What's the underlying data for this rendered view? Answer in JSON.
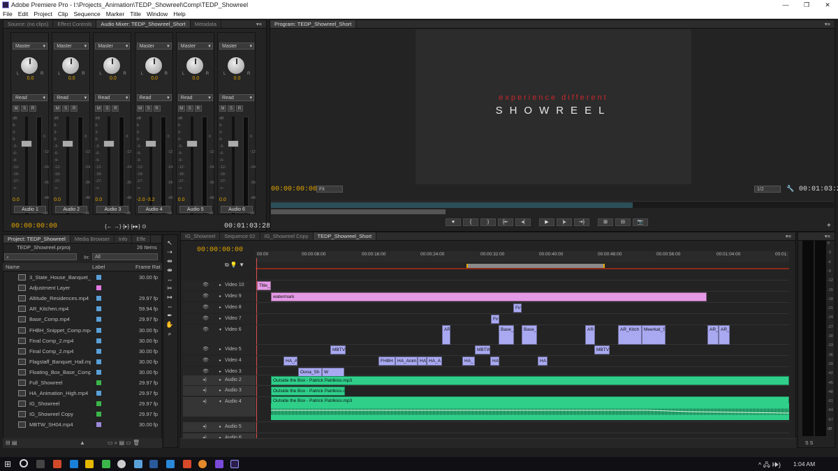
{
  "window": {
    "title": "Adobe Premiere Pro - I:\\Projects_Animation\\TEDP_Showreel\\Comp\\TEDP_Showreel",
    "controls": [
      "—",
      "❐",
      "✕"
    ]
  },
  "menu": [
    "File",
    "Edit",
    "Project",
    "Clip",
    "Sequence",
    "Marker",
    "Title",
    "Window",
    "Help"
  ],
  "source_tabs": [
    "Source: (no clips)",
    "Effect Controls",
    "Audio Mixer: TEDP_Showreel_Short",
    "Metadata"
  ],
  "mixer": {
    "strips": [
      {
        "mode": "Master",
        "pan": "0.0",
        "automation": "Read",
        "value": "0.0",
        "name": "Audio 1"
      },
      {
        "mode": "Master",
        "pan": "0.0",
        "automation": "Read",
        "value": "0.0",
        "name": "Audio 2"
      },
      {
        "mode": "Master",
        "pan": "0.0",
        "automation": "Read",
        "value": "0.0",
        "name": "Audio 3"
      },
      {
        "mode": "Master",
        "pan": "0.0",
        "automation": "Read",
        "value": "-2.0  -3.2",
        "name": "Audio 4"
      },
      {
        "mode": "Master",
        "pan": "0.0",
        "automation": "Read",
        "value": "0.0",
        "name": "Audio 5"
      },
      {
        "mode": "Master",
        "pan": "0.0",
        "automation": "Read",
        "value": "0.0",
        "name": "Audio 6"
      }
    ],
    "timecode_left": "00:00:00:00",
    "timecode_right": "00:01:03:28",
    "transport": "{← →} {▸} {▸▸} ⊙",
    "hsr": [
      "M",
      "S",
      "R"
    ],
    "db_ticks": [
      "dB",
      "6-",
      "3-",
      "0-",
      "-3-",
      "-6-",
      "-9-",
      "-12-",
      "-18-",
      "-27-",
      "-∞"
    ],
    "meter_ticks": [
      "0",
      "-12",
      "-24",
      "-36",
      "-48",
      "dB"
    ]
  },
  "program": {
    "tab": "Program: TEDP_Showreel_Short",
    "tagline": "experience different",
    "title": "SHOWREEL",
    "timecode": "00:00:00:00",
    "fit": "Fit",
    "resolution": "1/2",
    "duration": "00:01:03:28",
    "buttons": [
      "♥",
      "{",
      "}",
      "{⇤",
      "◂|",
      "▶",
      "|▸",
      "⇥}",
      "⊞",
      "⊟",
      "📷"
    ]
  },
  "project": {
    "tabs": [
      "Project: TEDP_Showreel",
      "Media Browser",
      "Info",
      "Effe"
    ],
    "file": "TEDP_Showreel.prproj",
    "count": "26 Items",
    "search_placeholder": "",
    "in_label": "In:",
    "in_value": "All",
    "columns": [
      "Name",
      "Label",
      "Frame Rat"
    ],
    "items": [
      {
        "name": "3_State_House_Banquet_F",
        "color": "#5aa0d8",
        "fps": "30.00 fp"
      },
      {
        "name": "Adjustment Layer",
        "color": "#e47ae4",
        "fps": ""
      },
      {
        "name": "Altitude_Residences.mp4",
        "color": "#5aa0d8",
        "fps": "29.97 fp"
      },
      {
        "name": "AR_Kitchen.mp4",
        "color": "#5aa0d8",
        "fps": "59.94 fp"
      },
      {
        "name": "Base_Comp.mp4",
        "color": "#5aa0d8",
        "fps": "29.97 fp"
      },
      {
        "name": "FHBH_Snippet_Comp.mp4",
        "color": "#5aa0d8",
        "fps": "30.00 fp"
      },
      {
        "name": "Final Comp_2.mp4",
        "color": "#5aa0d8",
        "fps": "30.00 fp"
      },
      {
        "name": "Final Comp_2.mp4",
        "color": "#5aa0d8",
        "fps": "30.00 fp"
      },
      {
        "name": "Flagstaff_Banquet_Hall.mp",
        "color": "#5aa0d8",
        "fps": "30.00 fp"
      },
      {
        "name": "Floating_Box_Base_Comp_",
        "color": "#5aa0d8",
        "fps": "30.00 fp"
      },
      {
        "name": "Full_Showreel",
        "color": "#3bb54a",
        "fps": "29.97 fp"
      },
      {
        "name": "HA_Animation_High.mp4",
        "color": "#5aa0d8",
        "fps": "29.97 fp"
      },
      {
        "name": "IG_Showreel",
        "color": "#3bb54a",
        "fps": "29.97 fp"
      },
      {
        "name": "IG_Showreel Copy",
        "color": "#3bb54a",
        "fps": "29.97 fp"
      },
      {
        "name": "MBTW_SH04.mp4",
        "color": "#9a8ad8",
        "fps": "30.00 fp"
      }
    ]
  },
  "timeline": {
    "tabs": [
      "IG_Showreel",
      "Sequence 02",
      "IG_Showreel Copy",
      "TEDP_Showreel_Short"
    ],
    "timecode": "00:00:00:00",
    "ruler": [
      "00:00",
      "00:00:08:00",
      "00:00:16:00",
      "00:00:24:00",
      "00:00:32:00",
      "00:00:40:00",
      "00:00:48:00",
      "00:00:56:00",
      "00:01:04:00",
      "00:01:"
    ],
    "tracks": [
      {
        "name": "Video 10",
        "type": "v"
      },
      {
        "name": "Video 9",
        "type": "v"
      },
      {
        "name": "Video 8",
        "type": "v"
      },
      {
        "name": "Video 7",
        "type": "v"
      },
      {
        "name": "Video 6",
        "type": "v"
      },
      {
        "name": "Video 5",
        "type": "v"
      },
      {
        "name": "Video 4",
        "type": "v"
      },
      {
        "name": "Video 3",
        "type": "v"
      },
      {
        "name": "Audio 2",
        "type": "a"
      },
      {
        "name": "Audio 3",
        "type": "a"
      },
      {
        "name": "Audio 4",
        "type": "a"
      },
      {
        "name": "Audio 5",
        "type": "a"
      },
      {
        "name": "Audio 6",
        "type": "a"
      }
    ],
    "clips": {
      "title": "Title_",
      "watermark": "watermark",
      "fin": "Fin",
      "fir": "Fir",
      "ar": "AR",
      "base1": "Base_",
      "base2": "Base_",
      "ar2": "AR",
      "ar_kitch": "AR_Kitch",
      "meerkat": "Meerkat_S",
      "ar3": "AR_",
      "ar4": "AR_",
      "mbtv1": "MBTV",
      "mbtw": "MBTW",
      "mbtv2": "MBTV",
      "ha_a": "HA_A",
      "fhbh": "FHBH",
      "ha_anim": "HA_Anim",
      "ha1": "HA",
      "ha_a2": "HA_A",
      "ha_": "HA_",
      "ha2": "HA",
      "ha3": "HA",
      "v3a": "Oona_Sh",
      "v3b": "W",
      "audio": "Outside the Box - Patrick Patrikios.mp3"
    }
  },
  "meter_scale": [
    "0",
    "-3",
    "-6",
    "-9",
    "-12",
    "-15",
    "-18",
    "-21",
    "-24",
    "-27",
    "-30",
    "-33",
    "-36",
    "-39",
    "-42",
    "-45",
    "-48",
    "-51",
    "-54",
    "-57",
    "dB"
  ],
  "taskbar": {
    "time": "1:04 AM",
    "tray": "^ 🖧 🕪)"
  }
}
